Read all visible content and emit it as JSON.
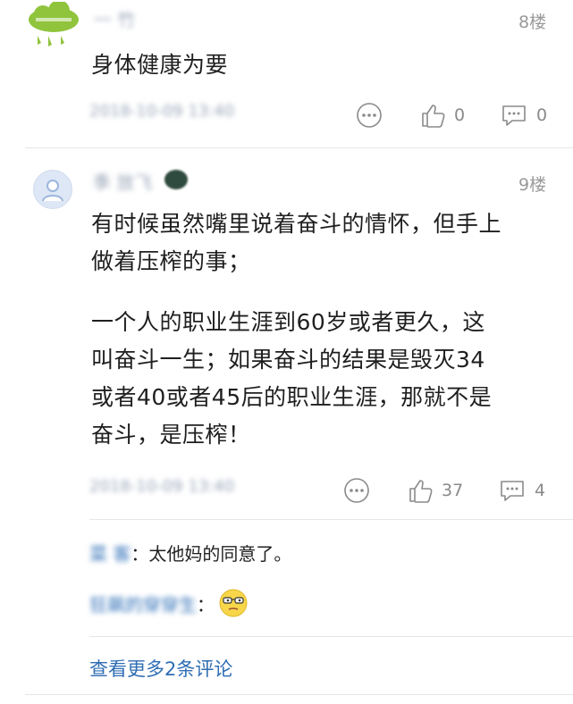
{
  "comment_8": {
    "user_name": "一 竹",
    "floor": "8楼",
    "text": "身体健康为要",
    "timestamp": "2018-10-09 13:40",
    "like_count": "0",
    "reply_count": "0"
  },
  "comment_9": {
    "user_name": "季 放飞",
    "floor": "9楼",
    "text_paragraph_1": [
      "有时候虽然嘴里说着奋斗的情怀，但手上",
      "做着压榨的事；"
    ],
    "text_paragraph_2": [
      "一个人的职业生涯到60岁或者更久，这",
      "叫奋斗一生；如果奋斗的结果是毁灭34",
      "或者40或者45后的职业生涯，那就不是",
      "奋斗，是压榨！"
    ],
    "timestamp": "2018-10-09 13:40",
    "like_count": "37",
    "reply_count": "4",
    "replies": [
      {
        "name": "菜 客",
        "separator": "：",
        "text": "太他妈的同意了。"
      },
      {
        "name": "狂飙的穿穿生",
        "separator": "：",
        "emoji": "sunglasses-emoji"
      }
    ],
    "more_replies": "查看更多2条评论"
  }
}
